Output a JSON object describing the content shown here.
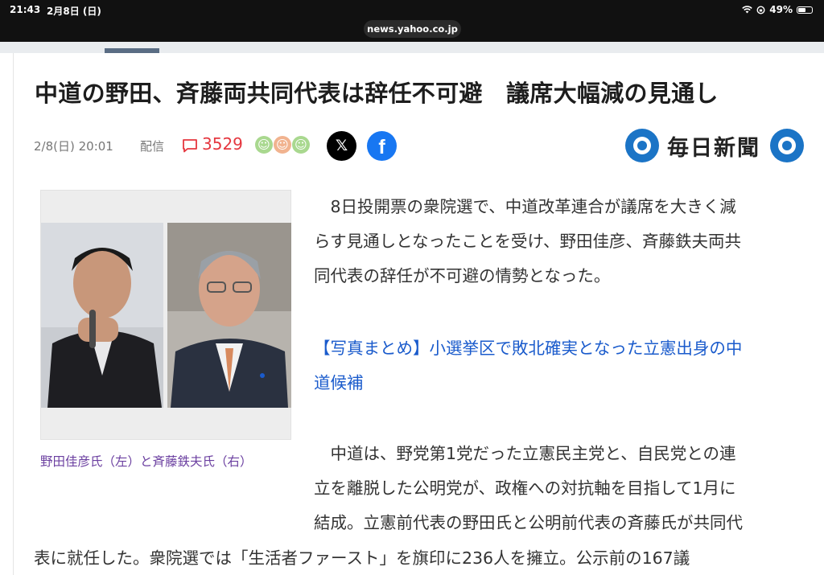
{
  "status": {
    "time": "21:43",
    "date": "2月8日 (日)",
    "battery": "49%",
    "battery_level": 0.49
  },
  "browser": {
    "url": "news.yahoo.co.jp"
  },
  "article": {
    "headline": "中道の野田、斉藤両共同代表は辞任不可避　議席大幅減の見通し",
    "date": "2/8(日) 20:01",
    "delivery_label": "配信",
    "comment_count": "3529",
    "share": {
      "x_label": "𝕏",
      "facebook_label": "f"
    },
    "publisher": "毎日新聞",
    "photo_caption": "野田佳彦氏（左）と斉藤鉄夫氏（右）",
    "paragraphs": [
      "　8日投開票の衆院選で、中道改革連合が議席を大きく減",
      "らす見通しとなったことを受け、野田佳彦、斉藤鉄夫両共",
      "同代表の辞任が不可避の情勢となった。"
    ],
    "link_lines": [
      "【写真まとめ】小選挙区で敗北確実となった立憲出身の中",
      "道候補"
    ],
    "paragraph2": [
      "　中道は、野党第1党だった立憲民主党と、自民党との連",
      "立を離脱した公明党が、政権への対抗軸を目指して1月に",
      "結成。立憲前代表の野田氏と公明前代表の斉藤氏が共同代"
    ],
    "wide_line": "表に就任した。衆院選では「生活者ファースト」を旗印に236人を擁立。公示前の167議"
  },
  "colors": {
    "accent_red": "#e5373f",
    "link_blue": "#1a5bcc",
    "caption_purple": "#6b3fa0",
    "facebook_blue": "#1877f2",
    "mainichi_blue": "#1b74c6"
  },
  "icons": [
    "wifi-icon",
    "battery-icon",
    "comment-icon",
    "x-logo-icon",
    "facebook-logo-icon",
    "mainichi-logo-icon"
  ]
}
